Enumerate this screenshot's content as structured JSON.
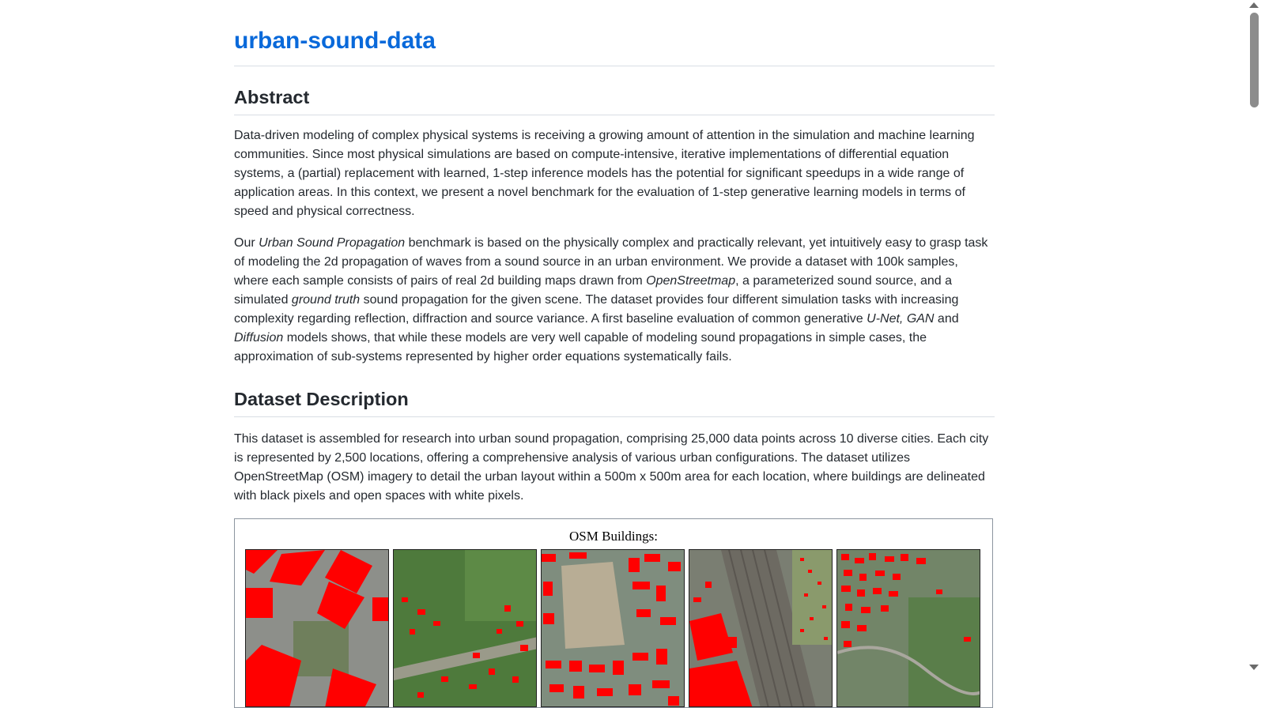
{
  "site": {
    "title": "urban-sound-data"
  },
  "abstract": {
    "heading": "Abstract",
    "p1": "Data-driven modeling of complex physical systems is receiving a growing amount of attention in the simulation and machine learning communities. Since most physical simulations are based on compute-intensive, iterative implementations of differential equation systems, a (partial) replacement with learned, 1-step inference models has the potential for significant speedups in a wide range of application areas. In this context, we present a novel benchmark for the evaluation of 1-step generative learning models in terms of speed and physical correctness.",
    "p2": {
      "t1": "Our ",
      "e1": "Urban Sound Propagation",
      "t2": " benchmark is based on the physically complex and practically relevant, yet intuitively easy to grasp task of modeling the 2d propagation of waves from a sound source in an urban environment. We provide a dataset with 100k samples, where each sample consists of pairs of real 2d building maps drawn from ",
      "e2": "OpenStreetmap",
      "t3": ", a parameterized sound source, and a simulated ",
      "e3": "ground truth",
      "t4": " sound propagation for the given scene. The dataset provides four different simulation tasks with increasing complexity regarding reflection, diffraction and source variance. A first baseline evaluation of common generative ",
      "e4": "U-Net, GAN",
      "t5": " and ",
      "e5": "Diffusion",
      "t6": " models shows, that while these models are very well capable of modeling sound propagations in simple cases, the approximation of sub-systems represented by higher order equations systematically fails."
    }
  },
  "dataset": {
    "heading": "Dataset Description",
    "p1": "This dataset is assembled for research into urban sound propagation, comprising 25,000 data points across 10 diverse cities. Each city is represented by 2,500 locations, offering a comprehensive analysis of various urban configurations. The dataset utilizes OpenStreetMap (OSM) imagery to detail the urban layout within a 500m x 500m area for each location, where buildings are delineated with black pixels and open spaces with white pixels."
  },
  "figure": {
    "title": "OSM Buildings:",
    "building_color": "#ff0000"
  },
  "colors": {
    "link": "#0969da",
    "text": "#24292f",
    "rule": "#d8dee4"
  }
}
